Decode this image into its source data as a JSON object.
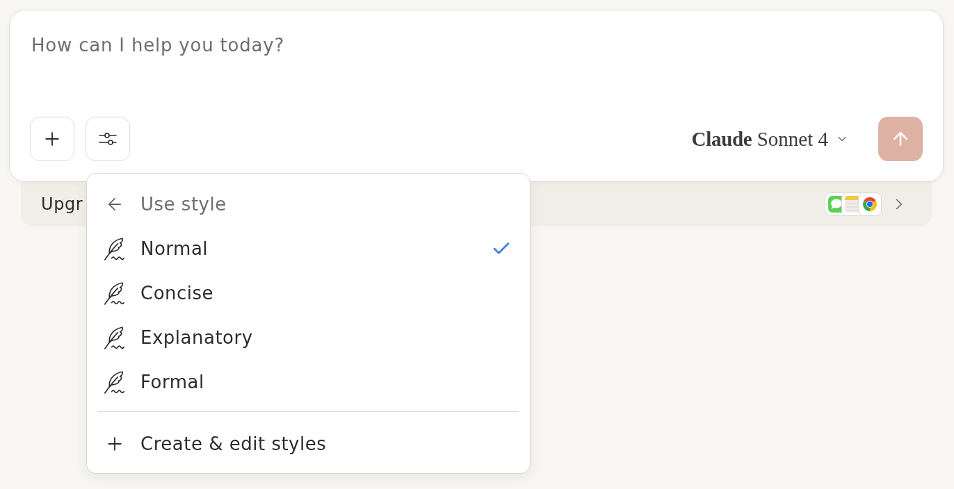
{
  "composer": {
    "placeholder": "How can I help you today?",
    "tools": [
      {
        "kind": "add"
      },
      {
        "kind": "styles"
      }
    ],
    "model_selector": {
      "brand": "Claude",
      "model": "Sonnet 4"
    },
    "send_button": {
      "disabled": true
    }
  },
  "tray": {
    "text": "Upgr"
  },
  "style_menu": {
    "title": "Use style",
    "items": [
      {
        "label": "Normal",
        "selected": true
      },
      {
        "label": "Concise",
        "selected": false
      },
      {
        "label": "Explanatory",
        "selected": false
      },
      {
        "label": "Formal",
        "selected": false
      }
    ],
    "action": "Create & edit styles"
  }
}
